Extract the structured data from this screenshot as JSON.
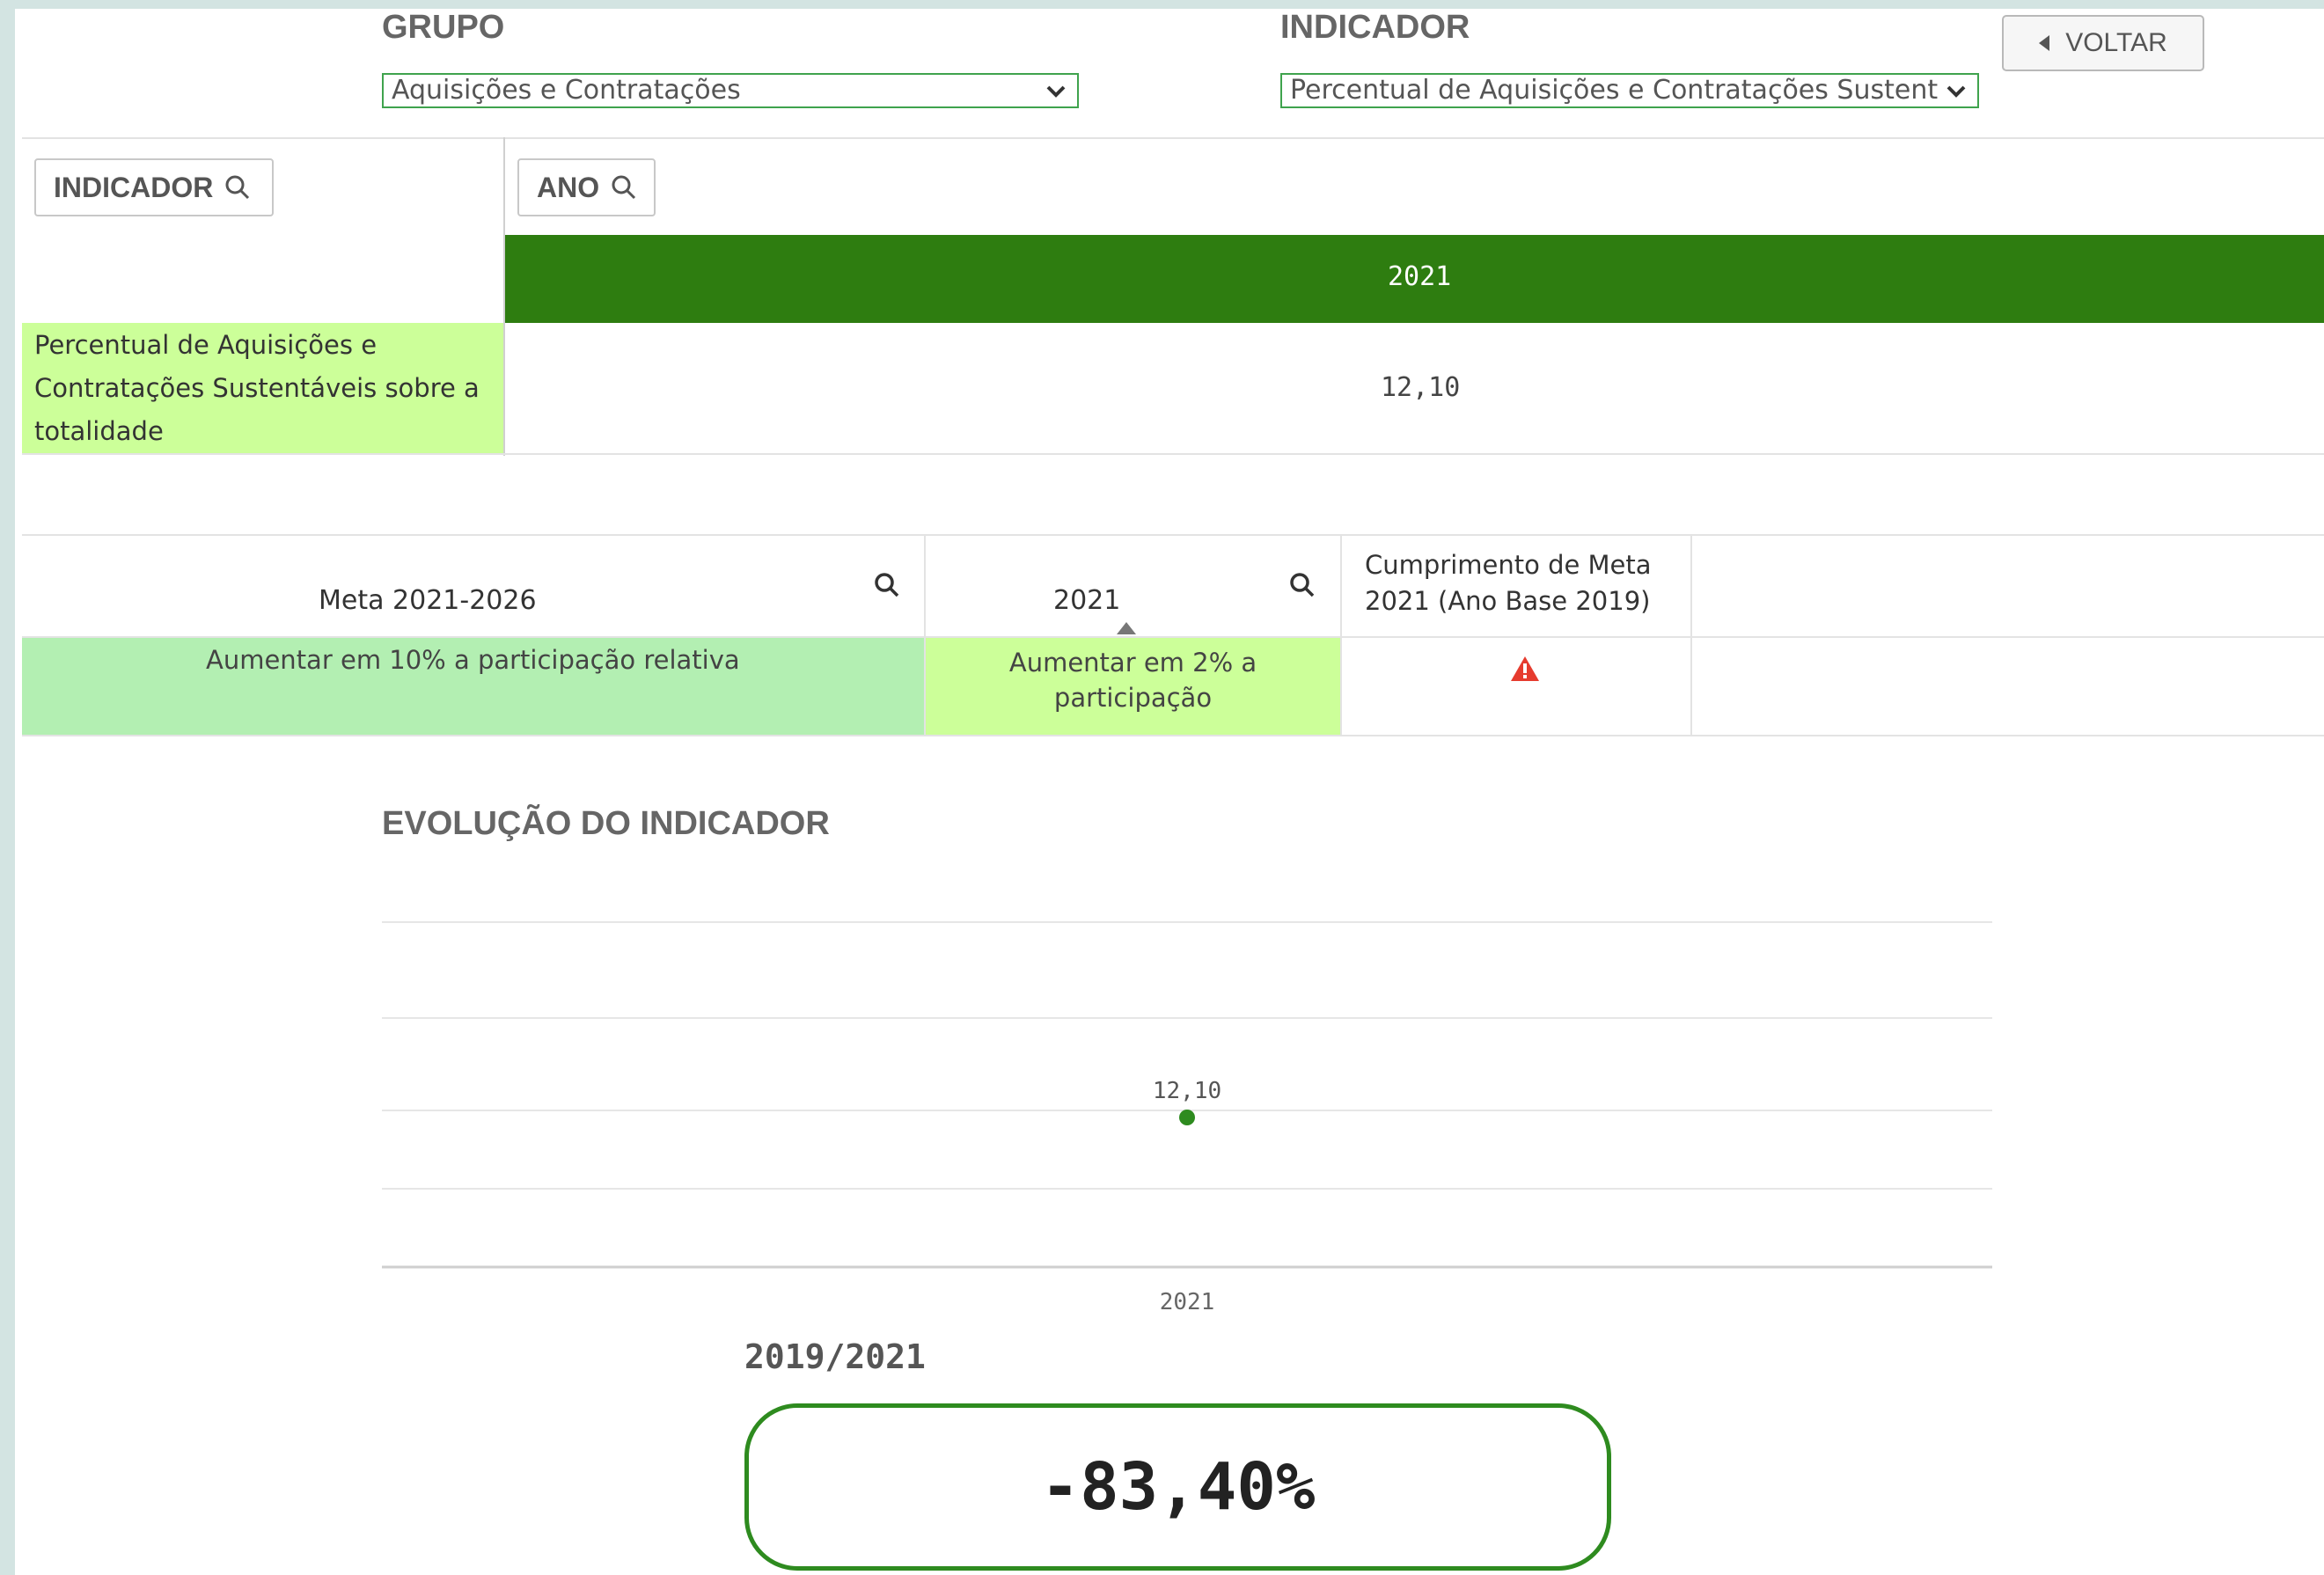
{
  "filters": {
    "grupo_label": "GRUPO",
    "grupo_value": "Aquisições e Contratações",
    "indicador_label": "INDICADOR",
    "indicador_value": "Percentual de Aquisições e Contratações Sustentáveis sobre a totalidade",
    "voltar_label": "VOLTAR"
  },
  "pivot": {
    "indicador_header": "INDICADOR",
    "ano_header": "ANO",
    "year": "2021",
    "row_label_lines": [
      "Percentual de Aquisições e",
      "Contratações Sustentáveis sobre a",
      "totalidade"
    ],
    "value": "12,10"
  },
  "meta_table": {
    "col1_header": "Meta 2021-2026",
    "col2_header": "2021",
    "col3_header_lines": [
      "Cumprimento de Meta",
      "2021 (Ano Base 2019)"
    ],
    "col1_value": "Aumentar em 10% a participação relativa",
    "col2_value_lines": [
      "Aumentar em 2% a",
      "participação"
    ],
    "status_icon": "warning-icon"
  },
  "chart_title": "EVOLUÇÃO DO INDICADOR",
  "chart_data": {
    "type": "scatter",
    "title": "EVOLUÇÃO DO INDICADOR",
    "categories": [
      "2021"
    ],
    "series": [
      {
        "values": [
          12.1
        ]
      }
    ],
    "data_labels": [
      "12,10"
    ],
    "grid": true
  },
  "kpi": {
    "label": "2019/2021",
    "value": "-83,40%"
  },
  "colors": {
    "header_green": "#2e7d10",
    "light_green": "#ccff99",
    "mint_green": "#b3efb2",
    "dot_green": "#2e8b1f",
    "warning_red": "#e63b2e"
  }
}
